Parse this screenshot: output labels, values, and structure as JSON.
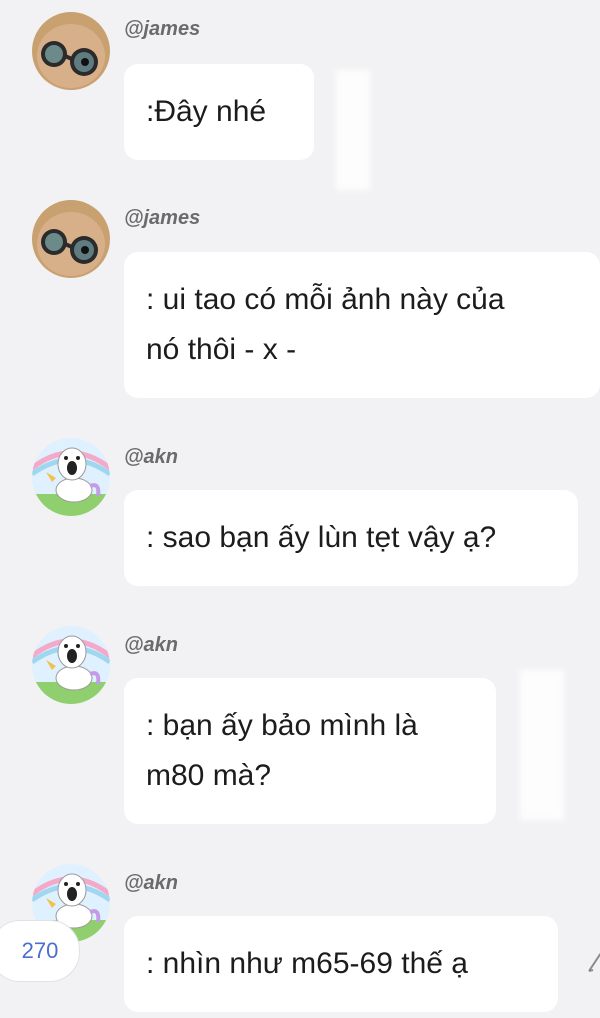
{
  "messages": [
    {
      "user": "@james",
      "avatar": "glasses-avatar-icon",
      "text": ":Đây nhé",
      "lines": [
        ":Đây nhé"
      ]
    },
    {
      "user": "@james",
      "avatar": "glasses-avatar-icon",
      "lines": [
        ": ui tao có mỗi ảnh này của",
        "nó thôi - x -"
      ]
    },
    {
      "user": "@akn",
      "avatar": "unicorn-avatar-icon",
      "lines": [
        ": sao bạn ấy lùn tẹt vậy ạ?"
      ]
    },
    {
      "user": "@akn",
      "avatar": "unicorn-avatar-icon",
      "lines": [
        ": bạn ấy bảo mình là",
        "m80 mà?"
      ]
    },
    {
      "user": "@akn",
      "avatar": "unicorn-avatar-icon",
      "lines": [
        ": nhìn như m65-69 thế ạ"
      ]
    }
  ],
  "counter": {
    "value": "270"
  },
  "icons": {
    "compose": "pen-icon"
  },
  "colors": {
    "background": "#f2f2f4",
    "bubble": "#ffffff",
    "username": "#6b6b6b",
    "counter_text": "#4a6fd0"
  }
}
